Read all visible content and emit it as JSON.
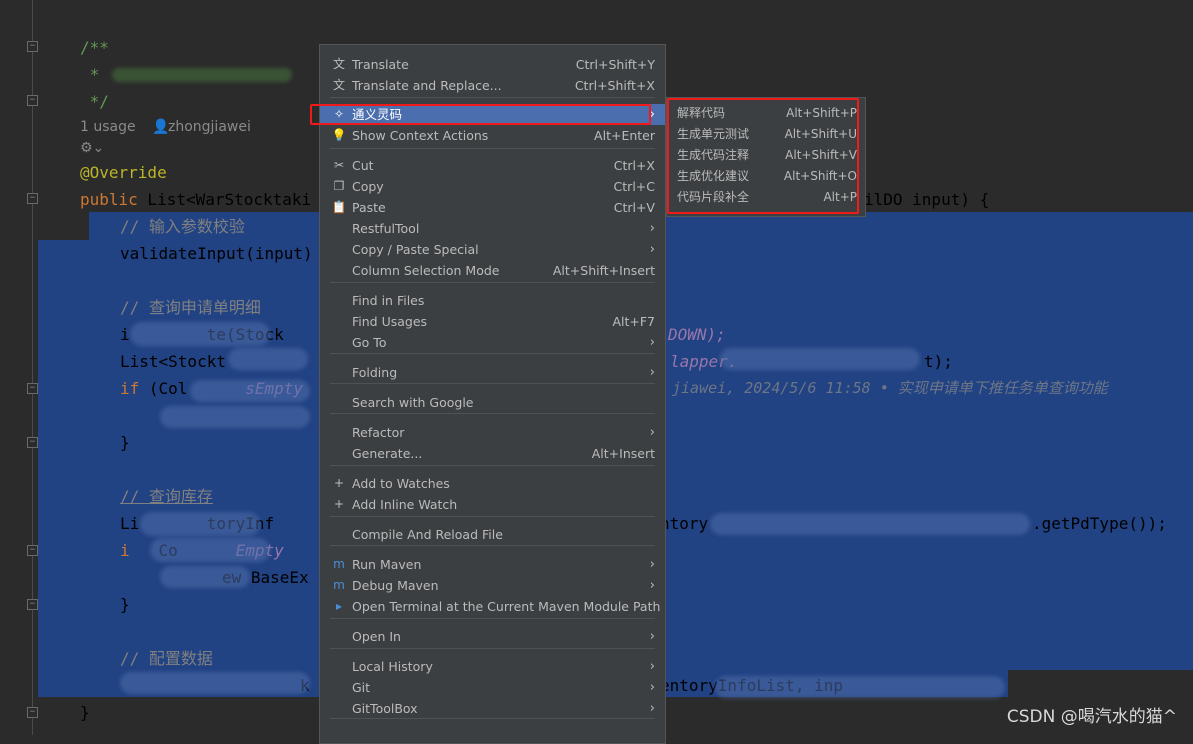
{
  "editor": {
    "doc_open": "/**",
    "doc_star": " *",
    "doc_close": " */",
    "usage": "1 usage",
    "author": "zhongjiawei",
    "annotation": "@Override",
    "signature_kw": "public",
    "signature_rest": " List<WarStocktaki",
    "signature_tail": "ilDO input) {",
    "c1": "// 输入参数校验",
    "l_validate": "validateInput(input)",
    "c2": "// 查询申请单明细",
    "l_i": "i",
    "l_i_mid": "te(Stock",
    "l_i_tail": "DOWN);",
    "l_list": "List<Stockt",
    "l_list_tail": "lapper.",
    "l_list_end": "t);",
    "l_if_kw": "if",
    "l_if": " (Col",
    "l_if_it": "sEmpty",
    "blame": "jiawei, 2024/5/6 11:58 • 实现申请单下推任务单查询功能",
    "brace": "}",
    "c3": "// 查询库存",
    "l_li": "Li",
    "l_li_mid": "toryInf",
    "l_li_tail": "ntory",
    "l_li_end": ".getPdType());",
    "l_if2_kw": "i",
    "l_if2": "Co",
    "l_if2_it": "Empty",
    "l_throw": "ew BaseEx",
    "c4": "// 配置数据",
    "l_last_mid": "k",
    "l_last_tail": "entoryInfoList, inp"
  },
  "context_menu": {
    "items": [
      {
        "label": "Translate",
        "shortcut": "Ctrl+Shift+Y",
        "icon": "translate-icon"
      },
      {
        "label": "Translate and Replace...",
        "shortcut": "Ctrl+Shift+X",
        "icon": "translate-replace-icon"
      },
      {
        "label": "通义灵码",
        "icon": "tongyi-lingma-icon",
        "submenu": true,
        "highlighted": true
      },
      {
        "label": "Show Context Actions",
        "shortcut": "Alt+Enter",
        "icon": "bulb-icon"
      },
      {
        "label": "Cut",
        "shortcut": "Ctrl+X",
        "icon": "scissors-icon"
      },
      {
        "label": "Copy",
        "shortcut": "Ctrl+C",
        "icon": "copy-icon"
      },
      {
        "label": "Paste",
        "shortcut": "Ctrl+V",
        "icon": "paste-icon"
      },
      {
        "label": "RestfulTool",
        "submenu": true
      },
      {
        "label": "Copy / Paste Special",
        "submenu": true
      },
      {
        "label": "Column Selection Mode",
        "shortcut": "Alt+Shift+Insert"
      },
      {
        "label": "Find in Files"
      },
      {
        "label": "Find Usages",
        "shortcut": "Alt+F7"
      },
      {
        "label": "Go To",
        "submenu": true
      },
      {
        "label": "Folding",
        "submenu": true
      },
      {
        "label": "Search with Google"
      },
      {
        "label": "Refactor",
        "submenu": true
      },
      {
        "label": "Generate...",
        "shortcut": "Alt+Insert"
      },
      {
        "label": "Add to Watches",
        "icon": "add-watch-icon"
      },
      {
        "label": "Add Inline Watch",
        "icon": "add-inline-watch-icon"
      },
      {
        "label": "Compile And Reload File"
      },
      {
        "label": "Run Maven",
        "submenu": true,
        "icon": "maven-run-icon"
      },
      {
        "label": "Debug Maven",
        "submenu": true,
        "icon": "maven-debug-icon"
      },
      {
        "label": "Open Terminal at the Current Maven Module Path",
        "icon": "maven-terminal-icon"
      },
      {
        "label": "Open In",
        "submenu": true
      },
      {
        "label": "Local History",
        "submenu": true
      },
      {
        "label": "Git",
        "submenu": true
      },
      {
        "label": "GitToolBox",
        "submenu": true
      }
    ]
  },
  "submenu": {
    "items": [
      {
        "label": "解释代码",
        "shortcut": "Alt+Shift+P"
      },
      {
        "label": "生成单元测试",
        "shortcut": "Alt+Shift+U"
      },
      {
        "label": "生成代码注释",
        "shortcut": "Alt+Shift+V"
      },
      {
        "label": "生成优化建议",
        "shortcut": "Alt+Shift+O"
      },
      {
        "label": "代码片段补全",
        "shortcut": "Alt+P"
      }
    ]
  },
  "watermark": "CSDN @喝汽水的猫^",
  "colors": {
    "selection": "#214283",
    "menu_bg": "#3c3f41",
    "highlight": "#4b6eaf",
    "annotation_box": "#f01a1a"
  }
}
